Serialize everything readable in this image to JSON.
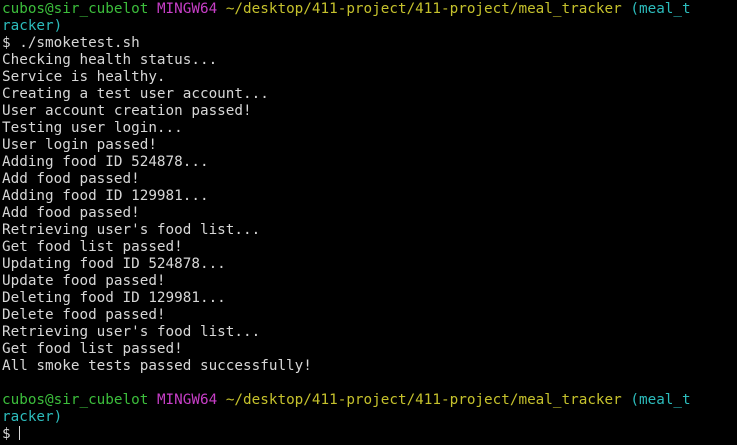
{
  "prompt1": {
    "user_host": "cubos@sir_cubelot",
    "system": "MINGW64",
    "path": "~/desktop/411-project/411-project/meal_tracker",
    "branch_part1": "(meal_t",
    "branch_part2": "racker)"
  },
  "command": {
    "symbol": "$",
    "text": "./smoketest.sh"
  },
  "output_lines": [
    "Checking health status...",
    "Service is healthy.",
    "Creating a test user account...",
    "User account creation passed!",
    "Testing user login...",
    "User login passed!",
    "Adding food ID 524878...",
    "Add food passed!",
    "Adding food ID 129981...",
    "Add food passed!",
    "Retrieving user's food list...",
    "Get food list passed!",
    "Updating food ID 524878...",
    "Update food passed!",
    "Deleting food ID 129981...",
    "Delete food passed!",
    "Retrieving user's food list...",
    "Get food list passed!",
    "All smoke tests passed successfully!"
  ],
  "prompt2": {
    "user_host": "cubos@sir_cubelot",
    "system": "MINGW64",
    "path": "~/desktop/411-project/411-project/meal_tracker",
    "branch_part1": "(meal_t",
    "branch_part2": "racker)",
    "symbol": "$"
  }
}
